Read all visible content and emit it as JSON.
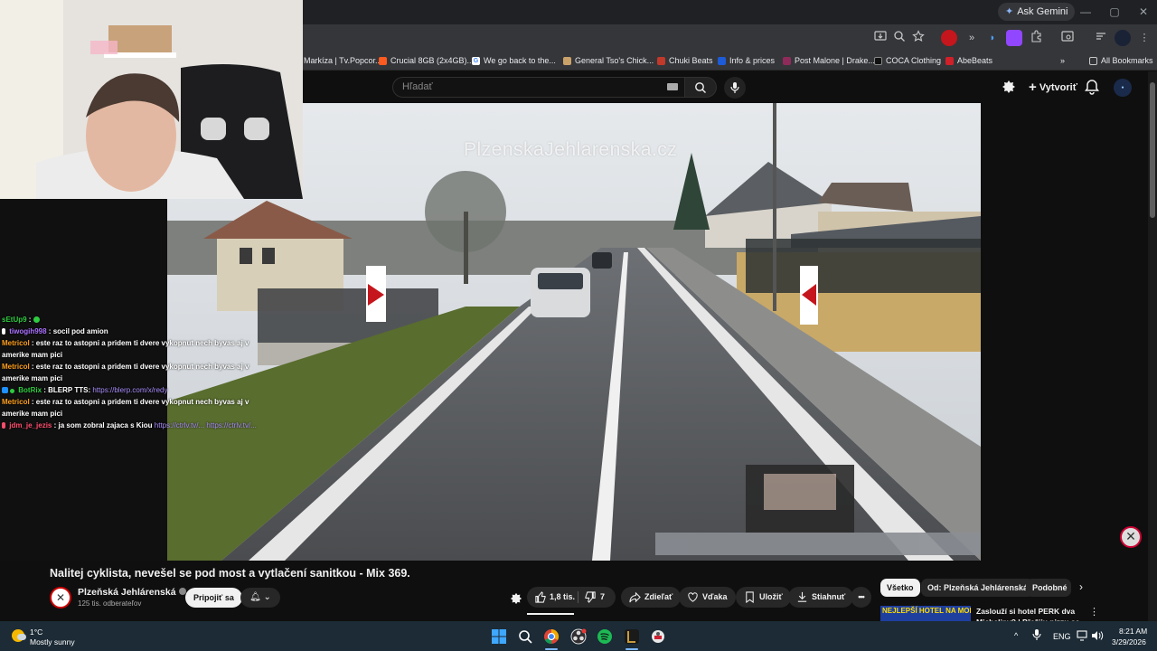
{
  "browser": {
    "ask_gemini": "Ask Gemini",
    "window_controls": [
      "—",
      "▢",
      "✕"
    ],
    "bookmarks": [
      {
        "label": "Markíza | Tv.Popcor...",
        "icon": "tv-icon",
        "color": "#3a3a3a"
      },
      {
        "label": "Crucial 8GB (2x4GB)...",
        "icon": "crucial-icon",
        "color": "#ff5a1f"
      },
      {
        "label": "We go back to the...",
        "icon": "google-icon",
        "color": "#ffffff"
      },
      {
        "label": "General Tso's Chick...",
        "icon": "recipe-icon",
        "color": "#c9a26a"
      },
      {
        "label": "Chuki Beats",
        "icon": "chuki-icon",
        "color": "#c0392b"
      },
      {
        "label": "Info & prices",
        "icon": "b-icon",
        "color": "#1e5bd6"
      },
      {
        "label": "Post Malone | Drake...",
        "icon": "music-icon",
        "color": "#8e2b5a"
      },
      {
        "label": "COCA Clothing",
        "icon": "coca-icon",
        "color": "#111111"
      },
      {
        "label": "AbeBeats",
        "icon": "abebeats-icon",
        "color": "#d0202a"
      }
    ],
    "all_bookmarks": "All Bookmarks",
    "more_bookmarks": "»"
  },
  "youtube": {
    "search_placeholder": "Hľadať",
    "create_label": "Vytvoriť",
    "video_title": "Nalitej cyklista, nevešel se pod most a vytlačení sanitkou - Mix 369.",
    "channel_name": "Plzeňská Jehlárenská",
    "subscribers": "125 tis. odberateľov",
    "join_label": "Pripojiť sa",
    "likes": "1,8 tis.",
    "dislikes": "7",
    "share_label": "Zdieľať",
    "thanks_label": "Vďaka",
    "save_label": "Uložiť",
    "download_label": "Stiahnuť",
    "more_label": "•••",
    "chips": [
      "Všetko",
      "Od: Plzeňská Jehlárenská",
      "Podobné"
    ],
    "rec_title": "Zaslouží si hotel PERK dva Michelinv? | Přežiju pizzu se",
    "rec_thumb_text": "NEJLEPŠÍ HOTEL NA MORAVĚ",
    "watermark": "PlzenskaJehlarenska.cz"
  },
  "chat": [
    {
      "user": "sEtUp9",
      "user_color": "#2ecc40",
      "sep": " :",
      "text": "",
      "badge_color": "#2ecc40"
    },
    {
      "user": "tiwogih998",
      "user_color": "#a970ff",
      "sep": " :",
      "text": "socil pod amion",
      "badge_color": "#ffffff"
    },
    {
      "user": "Metricol",
      "user_color": "#ff9f1a",
      "sep": " :",
      "text": "este raz to astopni a pridem ti dvere vykopnut nech byvas aj v amerike mam pici",
      "badge_color": ""
    },
    {
      "user": "Metricol",
      "user_color": "#ff9f1a",
      "sep": " :",
      "text": "este raz to astopni a pridem ti dvere vykopnut nech byvas aj v amerike mam pici",
      "badge_color": ""
    },
    {
      "user": "BotRix",
      "user_color": "#2ecc40",
      "sep": " :",
      "text": "BLERP TTS:",
      "link": "https://blerp.com/x/redy",
      "badge_color": "#1e90ff"
    },
    {
      "user": "Metricol",
      "user_color": "#ff9f1a",
      "sep": " :",
      "text": "este raz to astopni a pridem ti dvere vykopnut nech byvas aj v amerike mam pici",
      "badge_color": ""
    },
    {
      "user": "jdm_je_jezis",
      "user_color": "#ff4d6d",
      "sep": " :",
      "text": "ja som zobral zajaca s Kiou",
      "link": "https://ctrlv.tv/... https://ctrlv.tv/...",
      "badge_color": "#ff4d6d"
    }
  ],
  "taskbar": {
    "temp": "1°C",
    "weather": "Mostly sunny",
    "lang": "ENG",
    "time": "8:21 AM",
    "date": "3/29/2026"
  }
}
